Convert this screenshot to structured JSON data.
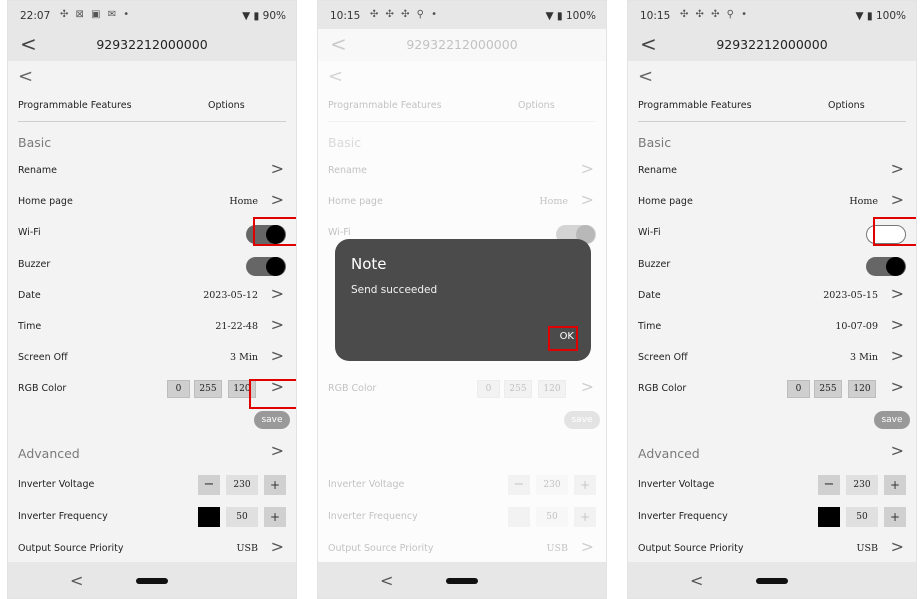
{
  "shared": {
    "left_col": "Programmable Features",
    "right_col": "Options",
    "basic": "Basic",
    "rename": "Rename",
    "home_page": "Home page",
    "home_value": "Home",
    "wifi": "Wi-Fi",
    "buzzer": "Buzzer",
    "date": "Date",
    "time": "Time",
    "screen_off": "Screen Off",
    "screen_off_value": "3 Min",
    "rgb": "RGB Color",
    "rgb_values": [
      "0",
      "255",
      "120"
    ],
    "save": "save",
    "advanced": "Advanced",
    "inv_voltage": "Inverter Voltage",
    "inv_voltage_value": "230",
    "inv_freq": "Inverter Frequency",
    "inv_freq_value": "50",
    "output_source": "Output Source Priority",
    "output_source_value": "USB",
    "minus": "−",
    "plus": "+",
    "chevron": ">",
    "back": "<"
  },
  "screens": [
    {
      "status_time": "22:07",
      "status_icons": "✣ ⊠ ▣ ✉ •",
      "battery": "▼ ▮ 90%",
      "title": "92932212000000",
      "date_value": "2023-05-12",
      "time_value": "21-22-48",
      "wifi_on": true
    },
    {
      "status_time": "10:15",
      "status_icons": "✣ ✣ ✣ ⚲ •",
      "battery": "▼ ▮ 100%",
      "title": "92932212000000",
      "dialog": {
        "title": "Note",
        "message": "Send succeeded",
        "ok": "OK"
      }
    },
    {
      "status_time": "10:15",
      "status_icons": "✣ ✣ ✣ ⚲ •",
      "battery": "▼ ▮ 100%",
      "title": "92932212000000",
      "date_value": "2023-05-15",
      "time_value": "10-07-09",
      "wifi_on": false
    }
  ]
}
